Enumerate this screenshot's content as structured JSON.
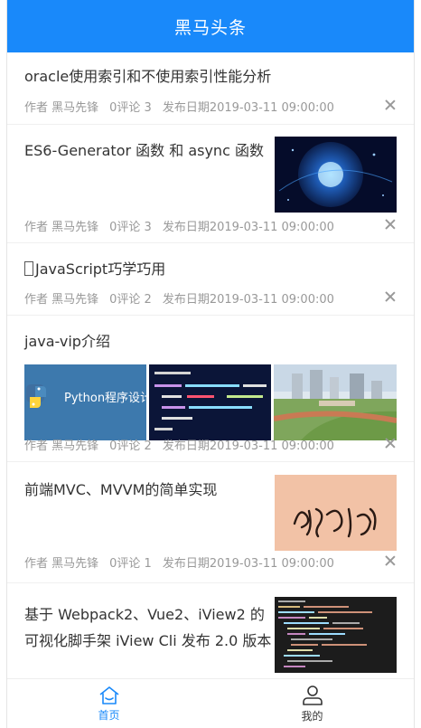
{
  "header": {
    "title": "黑马头条"
  },
  "articles": [
    {
      "title": "oracle使用索引和不使用索引性能分析",
      "author": "作者 黑马先锋",
      "comments": "0评论 3",
      "date": "发布日期2019-03-11 09:00:00"
    },
    {
      "title": "ES6-Generator 函数 和 async 函数",
      "author": "作者 黑马先锋",
      "comments": "0评论 3",
      "date": "发布日期2019-03-11 09:00:00"
    },
    {
      "title": "JavaScript巧学巧用",
      "author": "作者 黑马先锋",
      "comments": "0评论 2",
      "date": "发布日期2019-03-11 09:00:00"
    },
    {
      "title": "java-vip介绍",
      "author": "作者 黑马先锋",
      "comments": "0评论 2",
      "date": "发布日期2019-03-11 09:00:00",
      "thumb_text": "Python程序设计"
    },
    {
      "title": "前端MVC、MVVM的简单实现",
      "author": "作者 黑马先锋",
      "comments": "0评论 1",
      "date": "发布日期2019-03-11 09:00:00"
    },
    {
      "title_line1": "基于 Webpack2、Vue2、iView2 的",
      "title_line2": "可视化脚手架 iView Cli 发布 2.0 版本"
    }
  ],
  "tabbar": {
    "home_label": "首页",
    "mine_label": "我的"
  },
  "colors": {
    "primary": "#1989fa",
    "meta": "#999999"
  }
}
